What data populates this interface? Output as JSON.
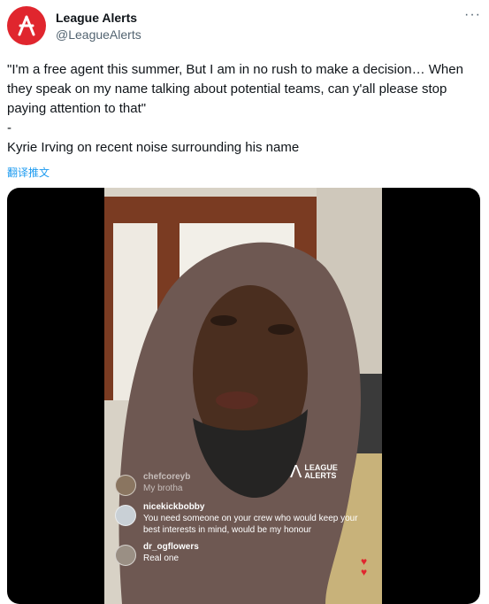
{
  "account": {
    "display_name": "League Alerts",
    "handle": "@LeagueAlerts",
    "avatar_icon": "league-alerts-logo-icon",
    "brand_color": "#e0262e"
  },
  "menu": {
    "more_label": "···"
  },
  "tweet": {
    "lines": [
      "\"I'm a free agent this summer, But I am in no rush to make a decision… When they speak on my name talking about potential teams, can y'all please stop paying attention to that\"",
      "-",
      "Kyrie Irving on recent noise surrounding his name"
    ],
    "translate_label": "翻译推文"
  },
  "video": {
    "watermark_line1": "LEAGUE",
    "watermark_line2": "ALERTS",
    "comments": [
      {
        "user": "chefcoreyb",
        "text": "My brotha"
      },
      {
        "user": "nicekickbobby",
        "text": "You need someone on your crew who would keep your best interests in mind, would be my honour"
      },
      {
        "user": "dr_ogflowers",
        "text": "Real one"
      }
    ]
  }
}
